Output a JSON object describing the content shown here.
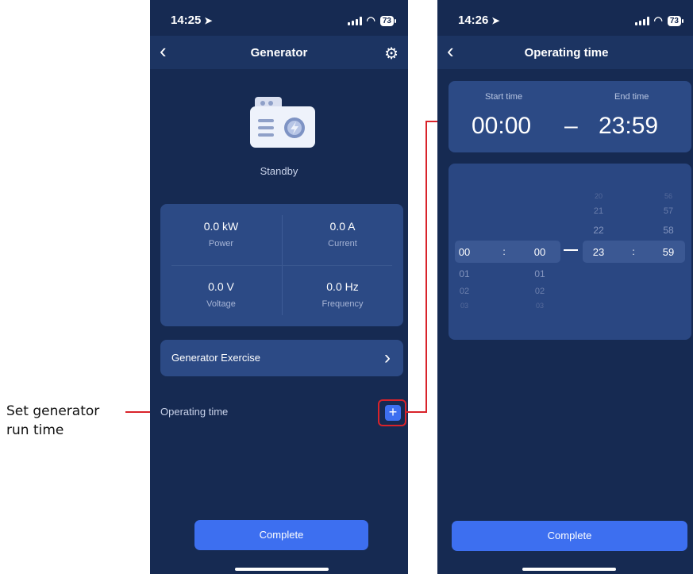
{
  "annotation": {
    "line1": "Set generator",
    "line2": "run time"
  },
  "left_screen": {
    "status_time": "14:25",
    "battery": "73",
    "title": "Generator",
    "device_status": "Standby",
    "metrics": [
      {
        "value": "0.0 kW",
        "label": "Power"
      },
      {
        "value": "0.0 A",
        "label": "Current"
      },
      {
        "value": "0.0 V",
        "label": "Voltage"
      },
      {
        "value": "0.0 Hz",
        "label": "Frequency"
      }
    ],
    "exercise_label": "Generator Exercise",
    "operating_time_label": "Operating time",
    "complete_label": "Complete"
  },
  "right_screen": {
    "status_time": "14:26",
    "battery": "73",
    "title": "Operating time",
    "start_label": "Start time",
    "end_label": "End time",
    "start_value": "00:00",
    "end_value": "23:59",
    "separator": "–",
    "picker": {
      "start_hour": "00",
      "start_minute": "00",
      "end_hour": "23",
      "end_minute": "59",
      "colon": ":",
      "start_hours_after": [
        "01",
        "02",
        "03"
      ],
      "start_minutes_after": [
        "01",
        "02",
        "03"
      ],
      "end_hours_before": [
        "20",
        "21",
        "22"
      ],
      "end_minutes_before": [
        "56",
        "57",
        "58"
      ]
    },
    "complete_label": "Complete"
  },
  "colors": {
    "screen_bg": "#162a52",
    "card_bg": "#2c4a85",
    "accent": "#3d6ff0",
    "highlight": "#d9232a"
  }
}
